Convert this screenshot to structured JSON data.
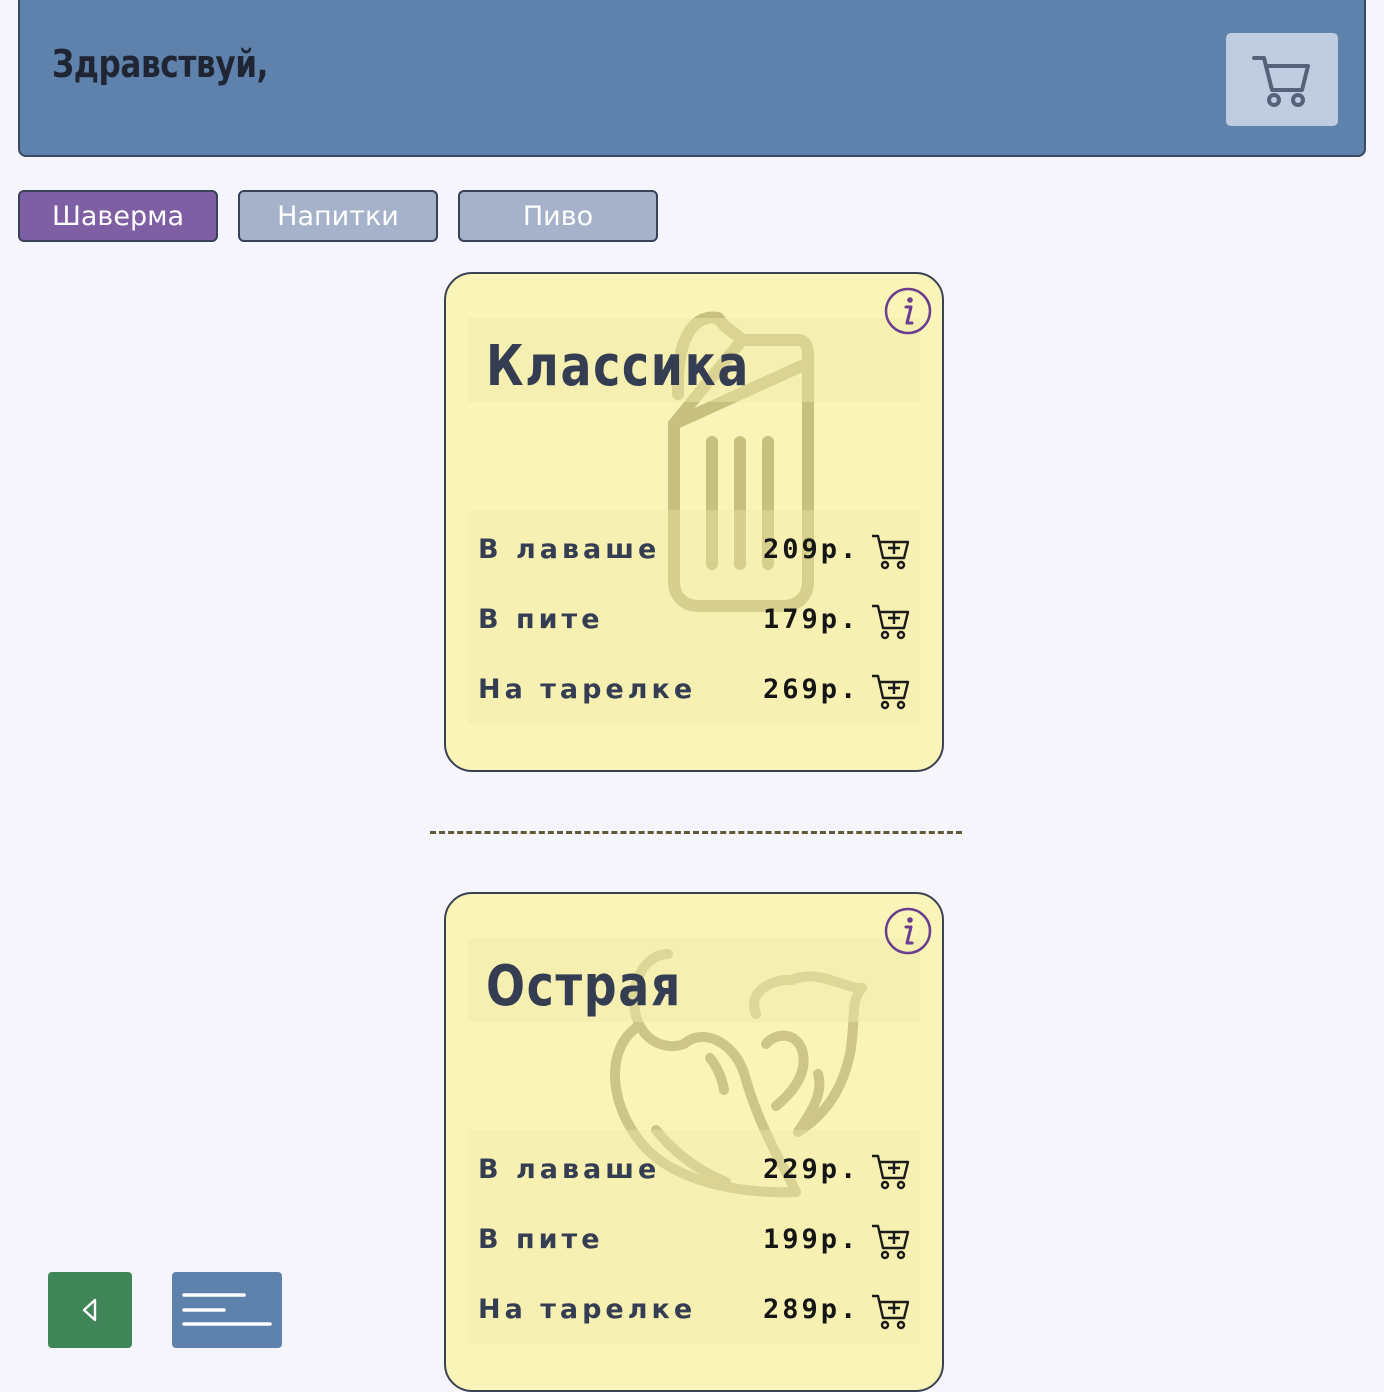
{
  "header": {
    "greeting": "Здравствуй,",
    "cart_icon": "shopping-cart-icon"
  },
  "tabs": [
    {
      "label": "Шаверма",
      "active": true
    },
    {
      "label": "Напитки",
      "active": false
    },
    {
      "label": "Пиво",
      "active": false
    }
  ],
  "products": [
    {
      "title": "Классика",
      "background_icon": "shawarma-wrap-icon",
      "info_icon": "info-icon",
      "options": [
        {
          "label": "В лаваше",
          "price": "209р."
        },
        {
          "label": "В пите",
          "price": "179р."
        },
        {
          "label": "На тарелке",
          "price": "269р."
        }
      ]
    },
    {
      "title": "Острая",
      "background_icon": "hot-pepper-flame-icon",
      "info_icon": "info-icon",
      "options": [
        {
          "label": "В лаваше",
          "price": "229р."
        },
        {
          "label": "В пите",
          "price": "199р."
        },
        {
          "label": "На тарелке",
          "price": "289р."
        }
      ]
    }
  ],
  "add_to_cart_icon": "cart-plus-icon",
  "bottom_bar": {
    "back_icon": "chevron-left-icon",
    "menu_icon": "menu-lines-icon"
  },
  "colors": {
    "header_bg": "#5f82ad",
    "active_tab": "#7f5fa3",
    "inactive_tab": "#a6b2c9",
    "card_bg": "#f9f4b8",
    "back_button": "#3f8558",
    "info_accent": "#6b3d8e"
  }
}
